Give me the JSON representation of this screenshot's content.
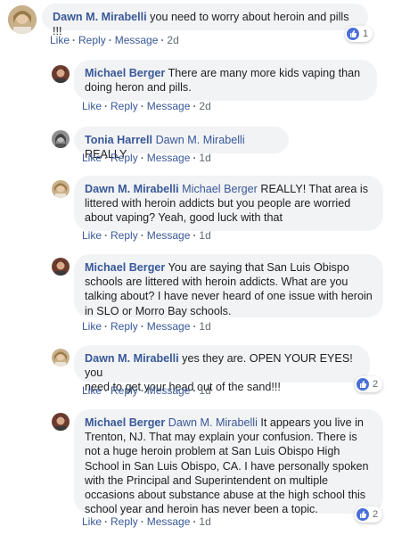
{
  "colors": {
    "link": "#385898",
    "bubble": "#f2f3f5",
    "meta": "#606770",
    "like_blue": "#4a6fd6"
  },
  "actions": {
    "like": "Like",
    "reply": "Reply",
    "message": "Message",
    "sep": "·"
  },
  "comments": [
    {
      "author": "Dawn M. Mirabelli",
      "mention": "",
      "lines": [
        "you need to worry about heroin and pills !!!"
      ],
      "time": "2d",
      "reactions": "1"
    },
    {
      "author": "Michael Berger",
      "mention": "",
      "lines": [
        "There are many more kids vaping than",
        "doing heron and pills."
      ],
      "time": "2d",
      "reactions": ""
    },
    {
      "author": "Tonia Harrell",
      "mention": "Dawn M. Mirabelli",
      "lines": [
        "REALLY"
      ],
      "time": "1d",
      "reactions": ""
    },
    {
      "author": "Dawn M. Mirabelli",
      "mention": "Michael Berger",
      "lines": [
        "REALLY! That area is",
        "littered with heroin addicts but you people are worried",
        "about vaping? Yeah, good luck with that"
      ],
      "time": "1d",
      "reactions": ""
    },
    {
      "author": "Michael Berger",
      "mention": "",
      "lines": [
        "You are saying that San Luis Obispo",
        "schools are littered with heroin addicts. What are you",
        "talking about? I have never heard of one issue with heroin",
        "in SLO or Morro Bay schools."
      ],
      "time": "1d",
      "reactions": ""
    },
    {
      "author": "Dawn M. Mirabelli",
      "mention": "",
      "lines": [
        "yes they are. OPEN YOUR EYES! you",
        "need to get your head out of the sand!!!"
      ],
      "time": "1d",
      "reactions": "2"
    },
    {
      "author": "Michael Berger",
      "mention": "Dawn M. Mirabelli",
      "lines": [
        "It appears you live in",
        "Trenton, NJ. That may explain your confusion. There is",
        "not a huge heroin problem at San Luis Obispo High",
        "School in San Luis Obispo, CA. I have personally spoken",
        "with the Principal and Superintendent on multiple",
        "occasions about substance abuse at the high school this",
        "school year and heroin has never been a topic."
      ],
      "time": "1d",
      "reactions": "2"
    }
  ]
}
